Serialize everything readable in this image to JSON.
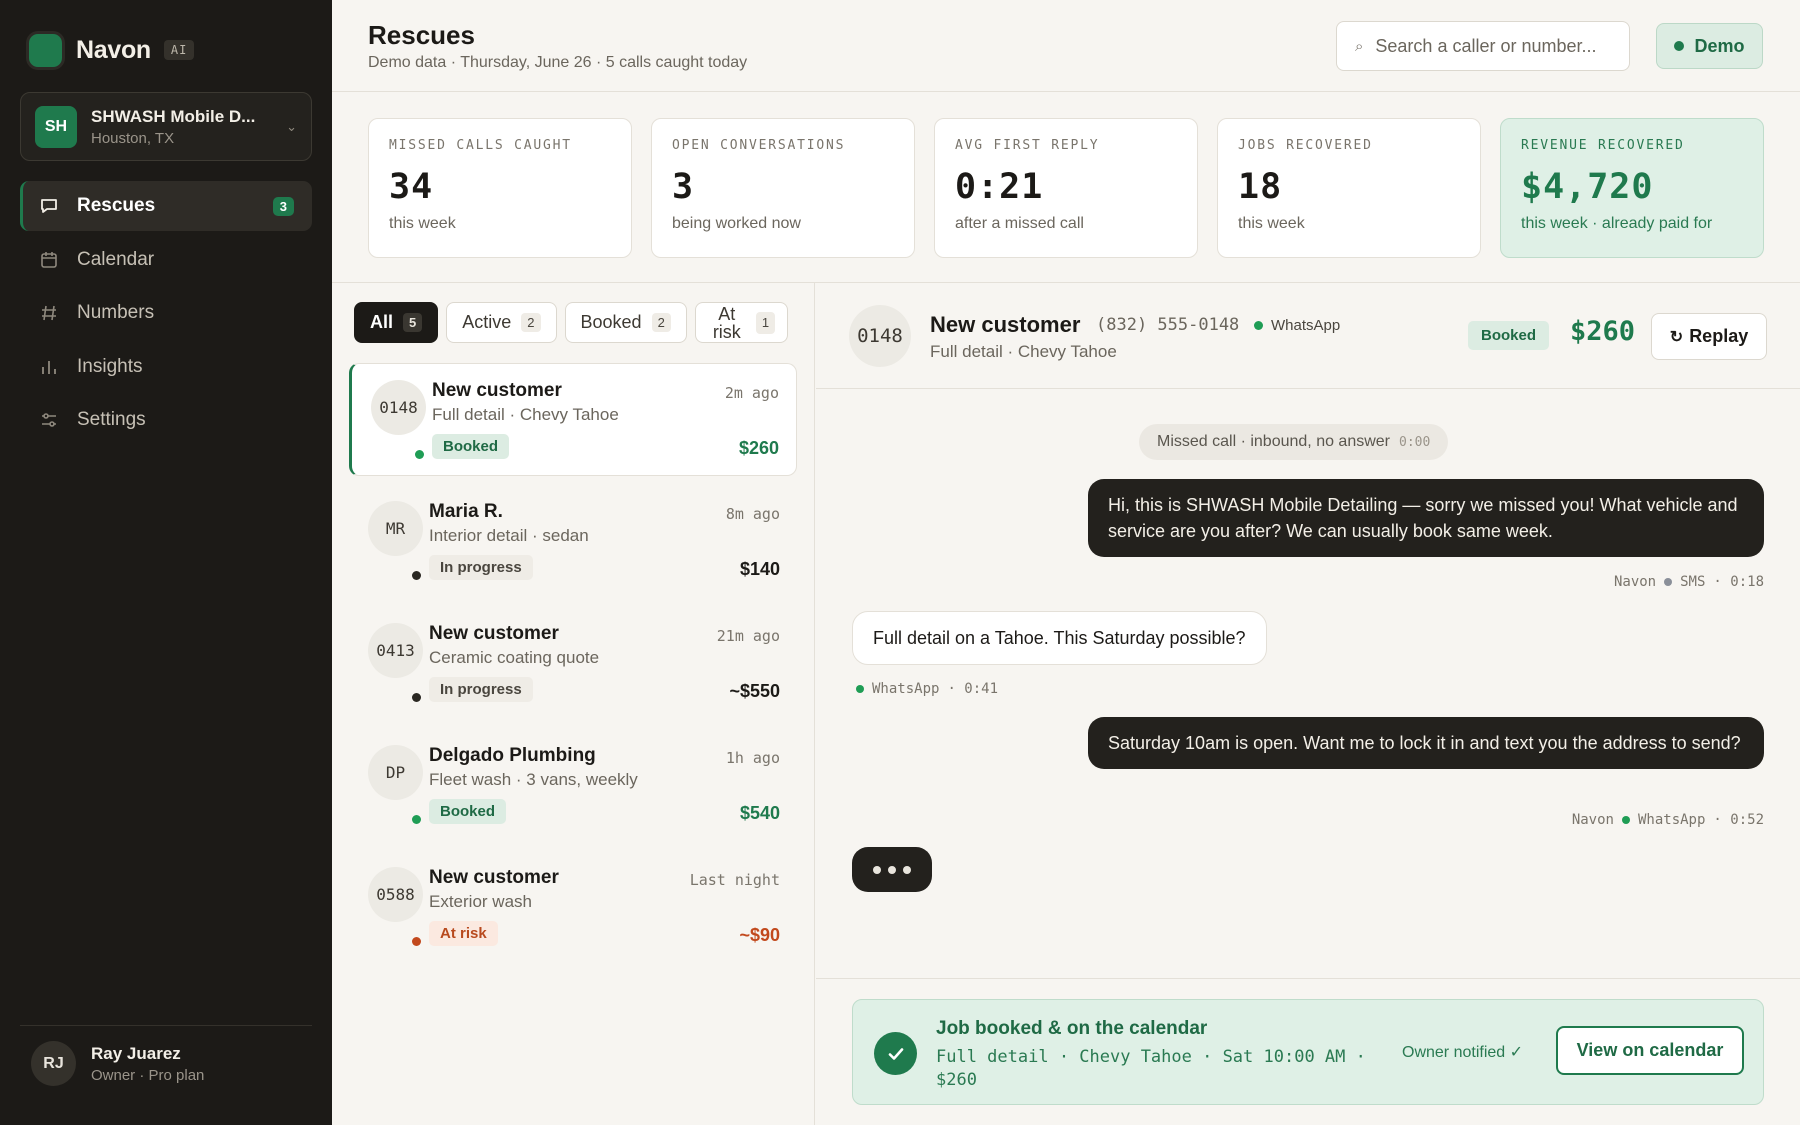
{
  "app": {
    "name": "Navon",
    "badge": "AI"
  },
  "workspace": {
    "initials": "SH",
    "name": "SHWASH Mobile D...",
    "location": "Houston, TX"
  },
  "nav": [
    {
      "label": "Rescues",
      "icon": "chat-bubble-icon",
      "count": "3",
      "active": true
    },
    {
      "label": "Calendar",
      "icon": "calendar-icon"
    },
    {
      "label": "Numbers",
      "icon": "hash-icon"
    },
    {
      "label": "Insights",
      "icon": "bar-chart-icon"
    },
    {
      "label": "Settings",
      "icon": "sliders-icon"
    }
  ],
  "user": {
    "initials": "RJ",
    "name": "Ray Juarez",
    "role": "Owner · Pro plan"
  },
  "header": {
    "title": "Rescues",
    "subtitle": "Demo data · Thursday, June 26 · 5 calls caught today",
    "search_placeholder": "Search a caller or number...",
    "demo_label": "Demo"
  },
  "stats": [
    {
      "label": "MISSED CALLS CAUGHT",
      "value": "34",
      "sub": "this week"
    },
    {
      "label": "OPEN CONVERSATIONS",
      "value": "3",
      "sub": "being worked now"
    },
    {
      "label": "AVG FIRST REPLY",
      "value": "0:21",
      "sub": "after a missed call"
    },
    {
      "label": "JOBS RECOVERED",
      "value": "18",
      "sub": "this week"
    },
    {
      "label": "REVENUE RECOVERED",
      "value": "$4,720",
      "sub": "this week · already paid for"
    }
  ],
  "filters": [
    {
      "label": "All",
      "count": "5",
      "active": true
    },
    {
      "label": "Active",
      "count": "2"
    },
    {
      "label": "Booked",
      "count": "2"
    },
    {
      "label": "At risk",
      "count": "1"
    }
  ],
  "conversations": [
    {
      "avatar": "0148",
      "name": "New customer",
      "detail": "Full detail · Chevy Tahoe",
      "time": "2m ago",
      "status": "Booked",
      "amount": "$260"
    },
    {
      "avatar": "MR",
      "name": "Maria R.",
      "detail": "Interior detail · sedan",
      "time": "8m ago",
      "status": "In progress",
      "amount": "$140"
    },
    {
      "avatar": "0413",
      "name": "New customer",
      "detail": "Ceramic coating quote",
      "time": "21m ago",
      "status": "In progress",
      "amount": "~$550"
    },
    {
      "avatar": "DP",
      "name": "Delgado Plumbing",
      "detail": "Fleet wash · 3 vans, weekly",
      "time": "1h ago",
      "status": "Booked",
      "amount": "$540"
    },
    {
      "avatar": "0588",
      "name": "New customer",
      "detail": "Exterior wash",
      "time": "Last night",
      "status": "At risk",
      "amount": "~$90"
    }
  ],
  "chat": {
    "avatar": "0148",
    "name": "New customer",
    "phone": "(832) 555-0148",
    "channel": "WhatsApp",
    "detail": "Full detail · Chevy Tahoe",
    "status": "Booked",
    "amount": "$260",
    "replay_label": "Replay",
    "system": {
      "text": "Missed call · inbound, no answer",
      "time": "0:00"
    },
    "messages": [
      {
        "text": "Hi, this is SHWASH Mobile Detailing — sorry we missed you! What vehicle and service are you after? We can usually book same week.",
        "sender": "Navon",
        "channel": "SMS",
        "time": "· 0:18"
      },
      {
        "text": "Full detail on a Tahoe. This Saturday possible?",
        "channel": "WhatsApp",
        "time": "· 0:41"
      },
      {
        "text": "Saturday 10am is open. Want me to lock it in and text you the address to send?",
        "sender": "Navon",
        "channel": "WhatsApp",
        "time": "· 0:52"
      }
    ]
  },
  "confirmation": {
    "title": "Job booked & on the calendar",
    "detail": "Full detail · Chevy Tahoe · Sat 10:00 AM · $260",
    "notified": "Owner notified ✓",
    "button_label": "View on calendar"
  },
  "colors": {
    "brand": "#1f7a4d",
    "sidebar": "#1c1a17",
    "risk": "#c2491d",
    "sms": "#8a8f99"
  }
}
